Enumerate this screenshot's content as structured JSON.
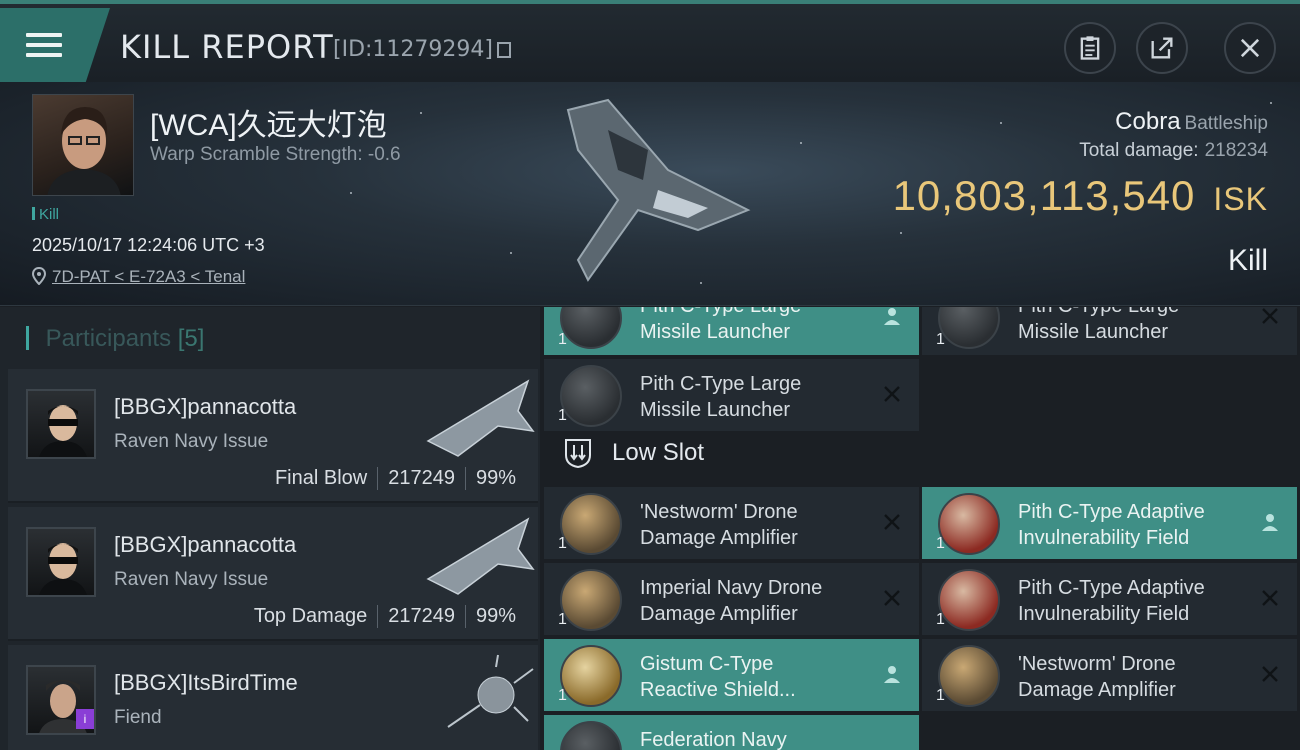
{
  "header": {
    "title": "KILL REPORT",
    "report_id": "[ID:11279294]",
    "icons": [
      "menu-icon",
      "clipboard-icon",
      "share-icon",
      "close-icon"
    ]
  },
  "victim": {
    "name": "[WCA]久远大灯泡",
    "warp_scramble": "Warp Scramble Strength: -0.6",
    "kill_tag": "Kill",
    "datetime": "2025/10/17 12:24:06 UTC +3",
    "location": "7D-PAT < E-72A3 < Tenal",
    "ship": "Cobra",
    "ship_class": "Battleship",
    "total_damage_label": "Total damage:",
    "total_damage_value": "218234",
    "isk_value": "10,803,113,540",
    "isk_unit": "ISK",
    "result": "Kill"
  },
  "participants": {
    "label": "Participants",
    "count": "[5]",
    "items": [
      {
        "name": "[BBGX]pannacotta",
        "ship": "Raven Navy Issue",
        "role": "Final Blow",
        "damage": "217249",
        "percent": "99%"
      },
      {
        "name": "[BBGX]pannacotta",
        "ship": "Raven Navy Issue",
        "role": "Top Damage",
        "damage": "217249",
        "percent": "99%"
      },
      {
        "name": "[BBGX]ItsBirdTime",
        "ship": "Fiend",
        "role": "",
        "damage": "",
        "percent": ""
      }
    ]
  },
  "fitting": {
    "high_slots": [
      {
        "name": "Pith C-Type Large\nMissile Launcher",
        "qty": "1",
        "status": "dropped"
      },
      {
        "name": "Pith C-Type Large\nMissile Launcher",
        "qty": "1",
        "status": "destroyed"
      },
      {
        "name": "Pith C-Type Large\nMissile Launcher",
        "qty": "1",
        "status": "destroyed"
      }
    ],
    "low_slot_label": "Low Slot",
    "low_slots": [
      {
        "name": "'Nestworm' Drone\nDamage Amplifier",
        "qty": "1",
        "status": "destroyed"
      },
      {
        "name": "Pith C-Type Adaptive\nInvulnerability Field",
        "qty": "1",
        "status": "dropped"
      },
      {
        "name": "Imperial Navy Drone\nDamage Amplifier",
        "qty": "1",
        "status": "destroyed"
      },
      {
        "name": "Pith C-Type Adaptive\nInvulnerability Field",
        "qty": "1",
        "status": "destroyed"
      },
      {
        "name": "Gistum C-Type\nReactive Shield...",
        "qty": "1",
        "status": "dropped"
      },
      {
        "name": "'Nestworm' Drone\nDamage Amplifier",
        "qty": "1",
        "status": "destroyed"
      },
      {
        "name": "Federation Navy",
        "qty": "",
        "status": "dropped"
      }
    ]
  },
  "colors": {
    "accent": "#3fa7a0",
    "dropped": "#3f8f86",
    "isk": "#e9c77a"
  }
}
